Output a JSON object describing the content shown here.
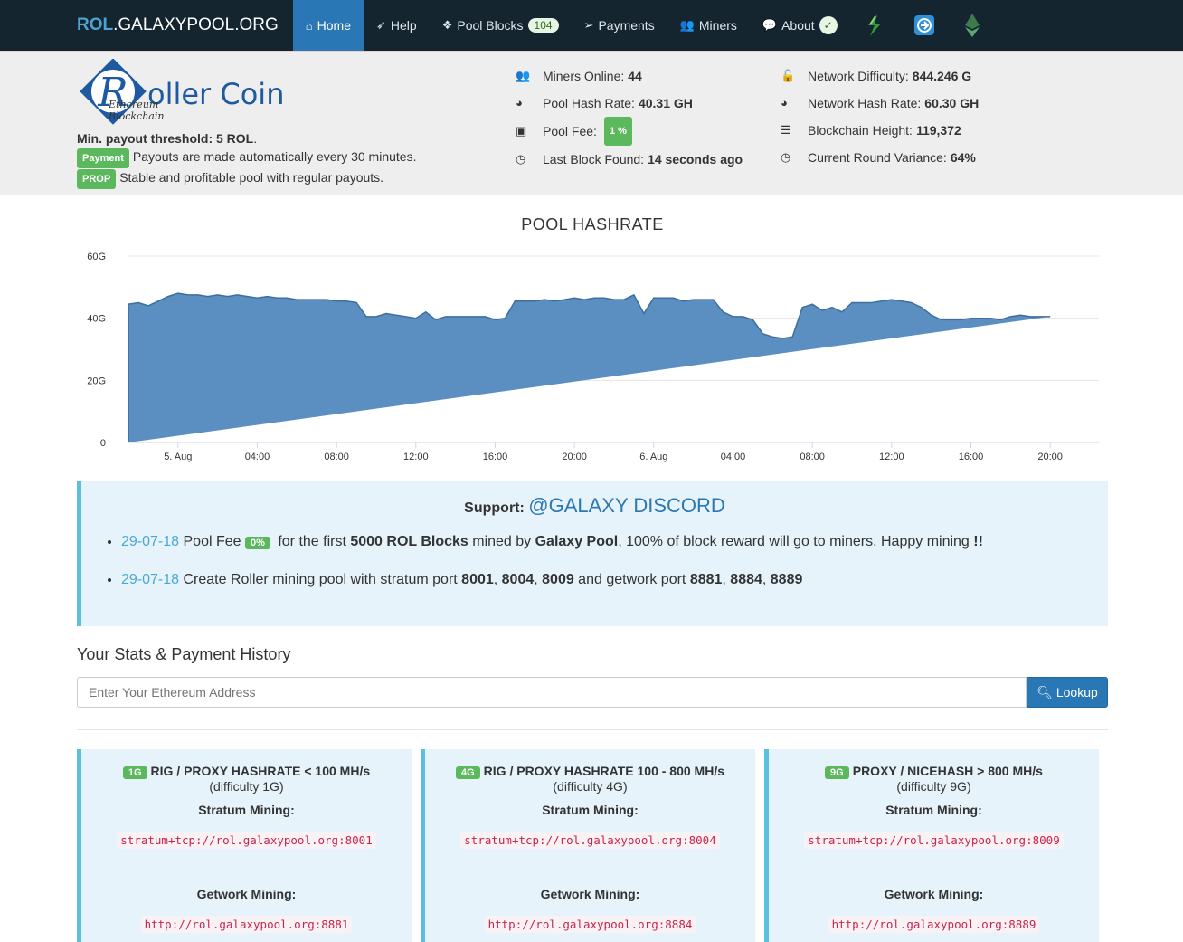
{
  "nav": {
    "brand_prefix": "ROL",
    "brand_suffix": ".GALAXYPOOL.ORG",
    "items": [
      {
        "label": "Home",
        "icon": "home-icon"
      },
      {
        "label": "Help",
        "icon": "rocket-icon"
      },
      {
        "label": "Pool Blocks",
        "icon": "cubes-icon",
        "badge": "104"
      },
      {
        "label": "Payments",
        "icon": "paper-plane-icon"
      },
      {
        "label": "Miners",
        "icon": "users-icon"
      },
      {
        "label": "About",
        "icon": "comments-icon",
        "badge": "✓"
      }
    ]
  },
  "logo": {
    "text": "oller Coin",
    "letter": "R",
    "subtitle": "Ethereum Blockchain"
  },
  "pool_info": {
    "min_payout_label": "Min. payout threshold:",
    "min_payout_value": "5 ROL",
    "payment_label": "Payment",
    "payment_text": "Payouts are made automatically every 30 minutes.",
    "prop_label": "PROP",
    "prop_text": "Stable and profitable pool with regular payouts."
  },
  "stats_left": [
    {
      "icon": "users-icon",
      "label": "Miners Online:",
      "value": "44"
    },
    {
      "icon": "tachometer-icon",
      "label": "Pool Hash Rate:",
      "value": "40.31 GH"
    },
    {
      "icon": "money-icon",
      "label": "Pool Fee:",
      "value": "1 %",
      "as_badge": true
    },
    {
      "icon": "clock-icon",
      "label": "Last Block Found:",
      "value": "14 seconds ago"
    }
  ],
  "stats_right": [
    {
      "icon": "unlock-icon",
      "label": "Network Difficulty:",
      "value": "844.246 G"
    },
    {
      "icon": "tachometer-icon",
      "label": "Network Hash Rate:",
      "value": "60.30 GH"
    },
    {
      "icon": "bars-icon",
      "label": "Blockchain Height:",
      "value": "119,372"
    },
    {
      "icon": "clock-icon",
      "label": "Current Round Variance:",
      "value": "64%"
    }
  ],
  "chart_data": {
    "type": "area",
    "title": "POOL HASHRATE",
    "ylim": [
      0,
      60
    ],
    "yticks": [
      "0",
      "20G",
      "40G",
      "60G"
    ],
    "ytick_values": [
      0,
      20,
      40,
      60
    ],
    "xticks": [
      "5. Aug",
      "04:00",
      "08:00",
      "12:00",
      "16:00",
      "20:00",
      "6. Aug",
      "04:00",
      "08:00",
      "12:00",
      "16:00",
      "20:00"
    ],
    "xtick_hours": [
      0,
      4,
      8,
      12,
      16,
      20,
      24,
      28,
      32,
      36,
      40,
      44
    ],
    "x_hours": [
      -2.5,
      -2,
      -1.5,
      -1,
      -0.5,
      0,
      0.5,
      1,
      1.5,
      2,
      2.5,
      3,
      3.5,
      4,
      4.5,
      5,
      5.5,
      6,
      6.5,
      7,
      7.5,
      8,
      8.5,
      9,
      9.5,
      10,
      10.5,
      11,
      11.5,
      12,
      12.5,
      13,
      13.5,
      14,
      14.5,
      15,
      15.5,
      16,
      16.5,
      17,
      17.5,
      18,
      18.5,
      19,
      19.5,
      20,
      20.5,
      21,
      21.5,
      22,
      22.5,
      23,
      23.5,
      24,
      24.5,
      25,
      25.5,
      26,
      26.5,
      27,
      27.5,
      28,
      28.5,
      29,
      29.5,
      30,
      30.5,
      31,
      31.5,
      32,
      32.5,
      33,
      33.5,
      34,
      34.5,
      35,
      35.5,
      36,
      36.5,
      37,
      37.5,
      38,
      38.5,
      39,
      39.5,
      40,
      40.5,
      41,
      41.5,
      42,
      42.5,
      43,
      43.5,
      44,
      44.5
    ],
    "values": [
      44.5,
      45,
      44,
      45.5,
      47,
      48,
      47.5,
      47.5,
      47,
      47.5,
      47,
      47.5,
      47,
      46.5,
      47,
      46.5,
      46.5,
      46,
      46,
      46,
      46,
      45.5,
      45.5,
      45,
      40.5,
      40.5,
      41.5,
      41,
      40.5,
      40,
      42,
      39.5,
      40.5,
      40.5,
      40.5,
      40.5,
      40.5,
      39.5,
      40,
      45.5,
      45.5,
      45.5,
      46,
      45.5,
      46,
      46.5,
      46,
      46.5,
      46.5,
      46,
      46,
      47.5,
      41.5,
      46.5,
      46.5,
      46.5,
      45.5,
      46,
      46,
      46,
      42,
      40.5,
      40.5,
      39.5,
      35,
      34,
      33.5,
      34,
      43.5,
      44.5,
      42.5,
      43.5,
      42,
      45,
      45,
      45,
      45.5,
      46,
      45.5,
      45,
      43.5,
      41,
      39.5,
      39.5,
      39.5,
      40,
      40,
      40,
      39.5,
      40.5,
      41,
      40.5,
      40.5,
      40.5
    ]
  },
  "support": {
    "label": "Support:",
    "link": "@GALAXY DISCORD",
    "news": [
      {
        "date": "29-07-18",
        "t1": " Pool Fee ",
        "badge": "0%",
        "t2": " for the first ",
        "b1": "5000 ROL Blocks",
        "t3": " mined by ",
        "b2": "Galaxy Pool",
        "t4": ", 100% of block reward will go to miners. Happy mining ",
        "b3": "!!"
      },
      {
        "date": "29-07-18",
        "t1": " Create Roller mining pool with stratum port ",
        "p1": "8001",
        "s1": ", ",
        "p2": "8004",
        "s2": ", ",
        "p3": "8009",
        "t2": " and getwork port ",
        "p4": "8881",
        "s3": ", ",
        "p5": "8884",
        "s4": ", ",
        "p6": "8889"
      }
    ]
  },
  "stats_section": {
    "title": "Your Stats & Payment History",
    "placeholder": "Enter Your Ethereum Address",
    "button": "Lookup"
  },
  "ports": [
    {
      "badge": "1G",
      "title": "RIG / PROXY HASHRATE < 100 MH/s",
      "difficulty": "(difficulty 1G)",
      "stratum_label": "Stratum Mining:",
      "stratum": "stratum+tcp://rol.galaxypool.org:8001",
      "getwork_label": "Getwork Mining:",
      "getwork": "http://rol.galaxypool.org:8881"
    },
    {
      "badge": "4G",
      "title": "RIG / PROXY HASHRATE 100 - 800 MH/s",
      "difficulty": "(difficulty 4G)",
      "stratum_label": "Stratum Mining:",
      "stratum": "stratum+tcp://rol.galaxypool.org:8004",
      "getwork_label": "Getwork Mining:",
      "getwork": "http://rol.galaxypool.org:8884"
    },
    {
      "badge": "9G",
      "title": "PROXY / NICEHASH > 800 MH/s",
      "difficulty": "(difficulty 9G)",
      "stratum_label": "Stratum Mining:",
      "stratum": "stratum+tcp://rol.galaxypool.org:8009",
      "getwork_label": "Getwork Mining:",
      "getwork": "http://rol.galaxypool.org:8889"
    }
  ],
  "colors": {
    "nav_bg": "#142530",
    "active": "#2a77b5",
    "area_fill": "#5b8fc2",
    "badge_green": "#5cb85c",
    "info_border": "#5bc0de"
  }
}
